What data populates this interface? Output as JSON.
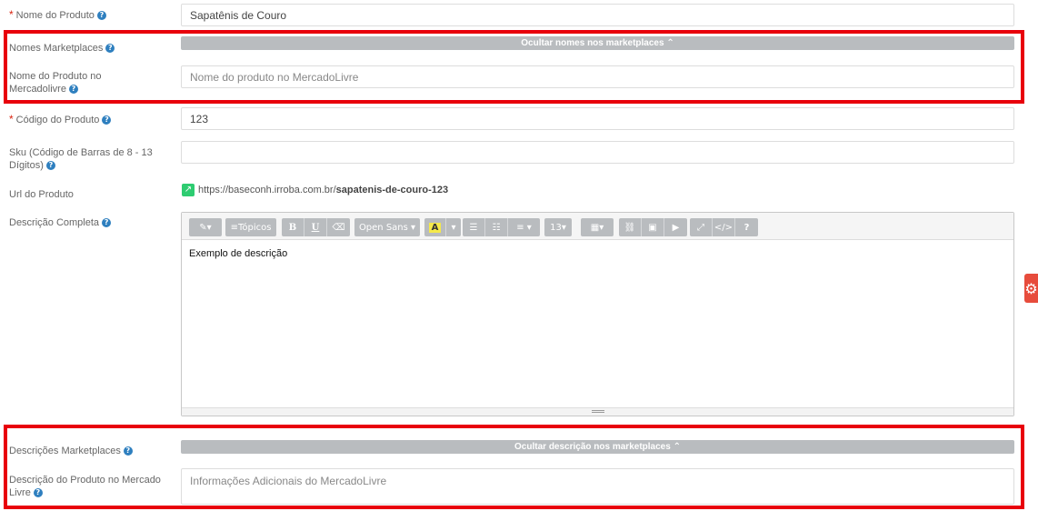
{
  "fields": {
    "product_name": {
      "label": "Nome do Produto",
      "value": "Sapatênis de Couro",
      "required": "*"
    },
    "marketplace_names": {
      "label": "Nomes Marketplaces",
      "toggle": "Ocultar nomes nos marketplaces"
    },
    "ml_name": {
      "label": "Nome do Produto no Mercadolivre",
      "placeholder": "Nome do produto no MercadoLivre"
    },
    "product_code": {
      "label": "Código do Produto",
      "value": "123",
      "required": "*"
    },
    "sku": {
      "label": "Sku (Código de Barras de 8 - 13 Dígitos)",
      "value": ""
    },
    "product_url": {
      "label": "Url do Produto",
      "base": "https://baseconh.irroba.com.br/",
      "slug": "sapatenis-de-couro-123"
    },
    "description": {
      "label": "Descrição Completa",
      "content": "Exemplo de descrição"
    },
    "marketplace_desc": {
      "label": "Descrições Marketplaces",
      "toggle": "Ocultar descrição nos marketplaces"
    },
    "ml_desc": {
      "label": "Descrição do Produto no Mercado Livre",
      "placeholder": "Informações Adicionais do MercadoLivre"
    }
  },
  "toolbar": {
    "topics": "Tópicos",
    "font": "Open Sans",
    "size": "13",
    "bold": "B",
    "underline": "U",
    "help": "?"
  },
  "icons": {
    "help": "question-circle",
    "external_link": "external-link",
    "gear": "gear"
  },
  "colors": {
    "accent": "#2e7fbf",
    "required": "#d9230f",
    "highlight_box": "#e8000b",
    "toggle_bar": "#b9bcbf",
    "url_icon": "#2ecc71",
    "side_tab": "#e74c3c"
  }
}
